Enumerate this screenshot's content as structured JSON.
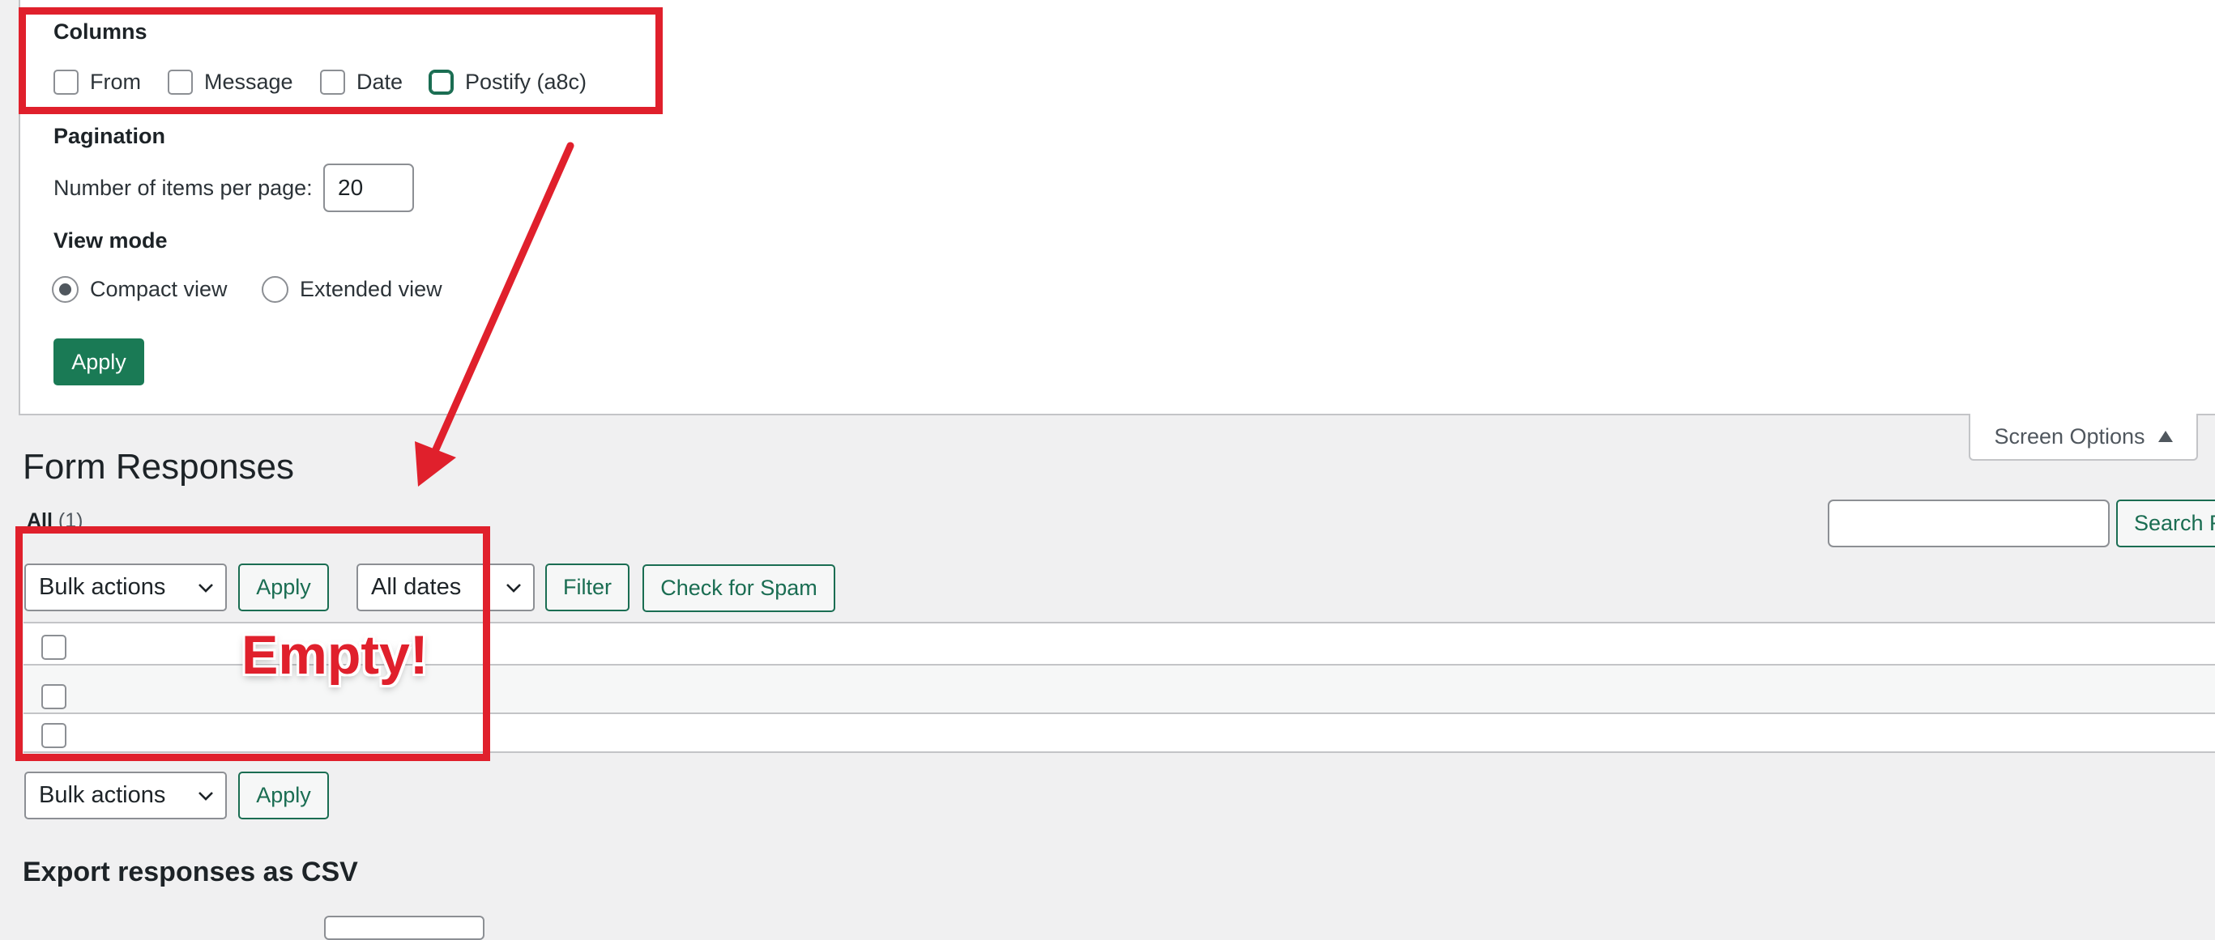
{
  "screen_options": {
    "columns": {
      "title": "Columns",
      "items": [
        {
          "label": "From",
          "checked": false
        },
        {
          "label": "Message",
          "checked": false
        },
        {
          "label": "Date",
          "checked": false
        },
        {
          "label": "Postify (a8c)",
          "checked": false,
          "focused": true
        }
      ]
    },
    "pagination": {
      "title": "Pagination",
      "per_page_label": "Number of items per page:",
      "per_page_value": "20"
    },
    "view_mode": {
      "title": "View mode",
      "options": [
        {
          "label": "Compact view",
          "selected": true
        },
        {
          "label": "Extended view",
          "selected": false
        }
      ]
    },
    "apply_label": "Apply",
    "tab_label": "Screen Options"
  },
  "page": {
    "title": "Form Responses",
    "filter_all_label": "All",
    "filter_all_count": "(1)",
    "search_button_label": "Search R"
  },
  "tablenav_top": {
    "bulk_actions": "Bulk actions",
    "apply_label": "Apply",
    "dates": "All dates",
    "filter_label": "Filter",
    "spam_label": "Check for Spam"
  },
  "tablenav_bottom": {
    "bulk_actions": "Bulk actions",
    "apply_label": "Apply"
  },
  "export": {
    "title": "Export responses as CSV"
  },
  "annotations": {
    "empty_label": "Empty!",
    "color": "#e0202c"
  },
  "colors": {
    "primary": "#1a7a55",
    "annotation": "#e0202c",
    "background": "#f0f0f1"
  }
}
